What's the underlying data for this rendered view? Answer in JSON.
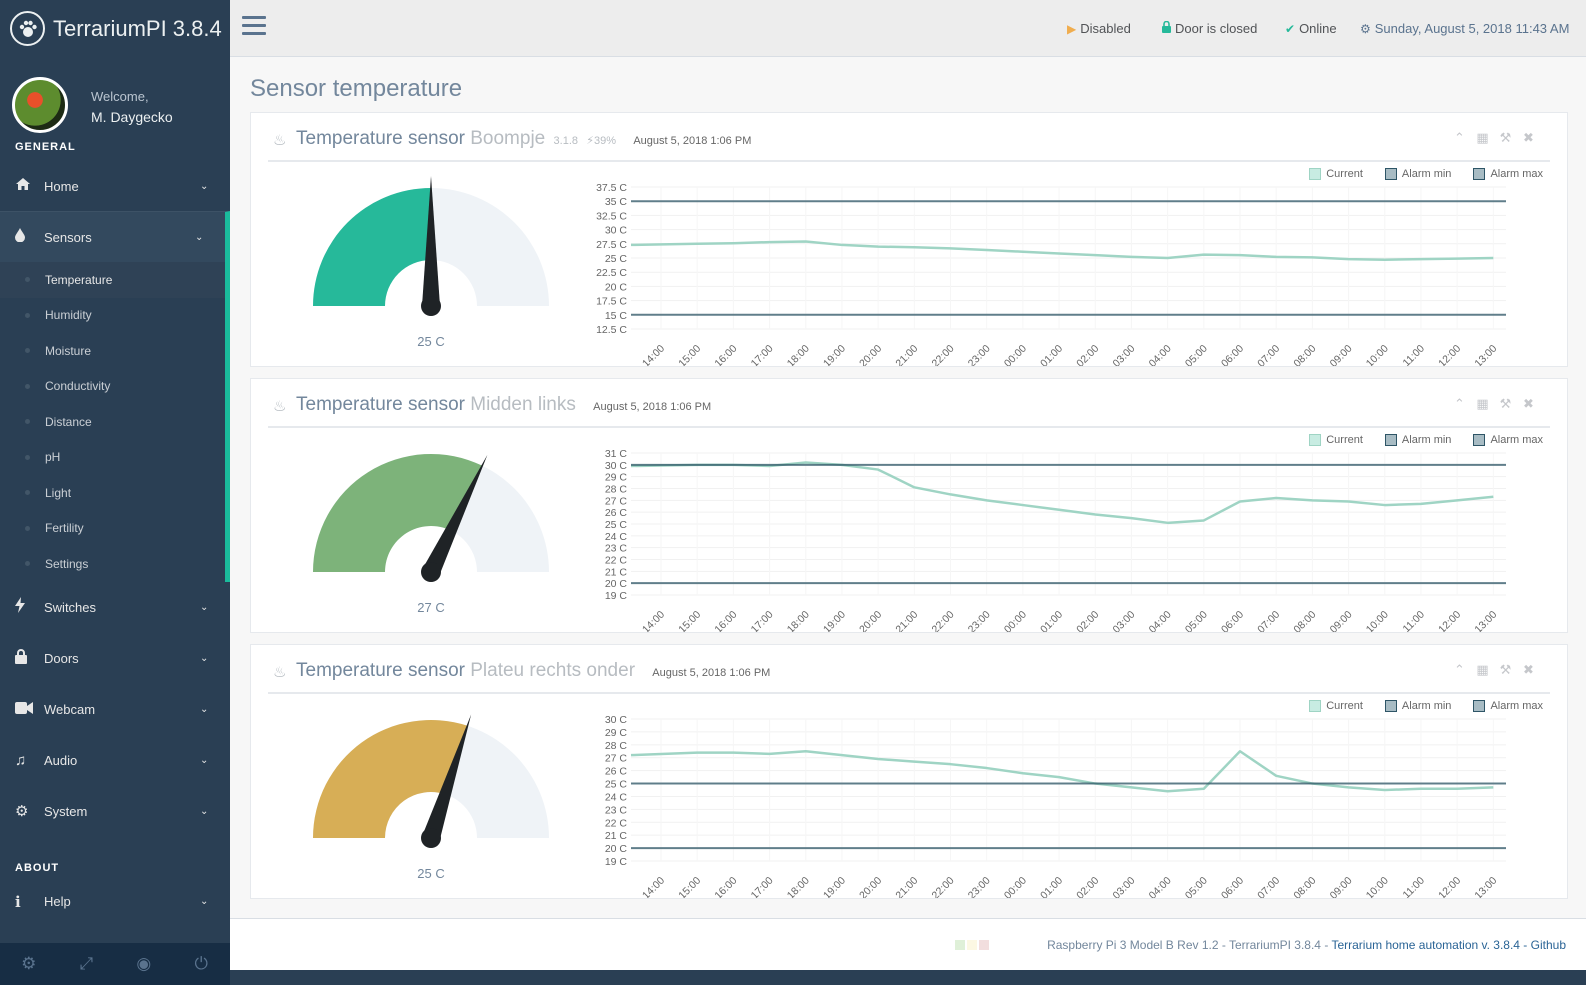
{
  "app": {
    "title": "TerrariumPI 3.8.4"
  },
  "profile": {
    "welcome": "Welcome,",
    "name": "M. Daygecko"
  },
  "sidebar": {
    "section_general": "GENERAL",
    "section_about": "ABOUT",
    "items": [
      {
        "label": "Home",
        "icon": "home-icon"
      },
      {
        "label": "Sensors",
        "icon": "drop-icon"
      },
      {
        "label": "Switches",
        "icon": "bolt-icon"
      },
      {
        "label": "Doors",
        "icon": "lock-icon"
      },
      {
        "label": "Webcam",
        "icon": "video-icon"
      },
      {
        "label": "Audio",
        "icon": "music-icon"
      },
      {
        "label": "System",
        "icon": "gear-icon"
      },
      {
        "label": "Help",
        "icon": "info-icon"
      }
    ],
    "sensor_sub": [
      "Temperature",
      "Humidity",
      "Moisture",
      "Conductivity",
      "Distance",
      "pH",
      "Light",
      "Fertility",
      "Settings"
    ]
  },
  "topbar": {
    "disabled": "Disabled",
    "door": "Door is closed",
    "online": "Online",
    "datetime": "Sunday, August 5, 2018 11:43 AM"
  },
  "page": {
    "title": "Sensor temperature"
  },
  "panels": [
    {
      "title_prefix": "Temperature sensor",
      "name": "Boompje",
      "version": "3.1.8",
      "battery": "39%",
      "timestamp": "August 5, 2018 1:06 PM",
      "gauge_label": "25 C"
    },
    {
      "title_prefix": "Temperature sensor",
      "name": "Midden links",
      "version": "",
      "battery": "",
      "timestamp": "August 5, 2018 1:06 PM",
      "gauge_label": "27 C"
    },
    {
      "title_prefix": "Temperature sensor",
      "name": "Plateu rechts onder",
      "version": "",
      "battery": "",
      "timestamp": "August 5, 2018 1:06 PM",
      "gauge_label": "25 C"
    }
  ],
  "legend": {
    "current": "Current",
    "alarm_min": "Alarm min",
    "alarm_max": "Alarm max"
  },
  "footer": {
    "text": "Raspberry Pi 3 Model B Rev 1.2 - TerrariumPI 3.8.4 - ",
    "link": "Terrarium home automation v. 3.8.4 - Github"
  },
  "colors": {
    "sidebar": "#2a3f54",
    "accent": "#1abb9c",
    "gauge_green": "#26b99a",
    "gauge_lightgreen": "#7db37a",
    "gauge_gold": "#d7ae56",
    "gauge_track": "#eff3f7",
    "line": "#9fd4c4",
    "alarm_line": "#2e5566"
  },
  "chart_data": [
    {
      "type": "line",
      "x": [
        "14:00",
        "15:00",
        "16:00",
        "17:00",
        "18:00",
        "19:00",
        "20:00",
        "21:00",
        "22:00",
        "23:00",
        "00:00",
        "01:00",
        "02:00",
        "03:00",
        "04:00",
        "05:00",
        "06:00",
        "07:00",
        "08:00",
        "09:00",
        "10:00",
        "11:00",
        "12:00",
        "13:00"
      ],
      "ylim": [
        12.5,
        37.5
      ],
      "yticks": [
        "12.5 C",
        "15 C",
        "17.5 C",
        "20 C",
        "22.5 C",
        "25 C",
        "27.5 C",
        "30 C",
        "32.5 C",
        "35 C",
        "37.5 C"
      ],
      "series": [
        {
          "name": "Current",
          "values": [
            27.3,
            27.5,
            27.6,
            27.8,
            27.9,
            27.3,
            27.0,
            26.9,
            26.7,
            26.4,
            26.1,
            25.8,
            25.5,
            25.2,
            25.0,
            25.6,
            25.5,
            25.2,
            25.1,
            24.8,
            24.7,
            24.8,
            24.9,
            25.0
          ]
        },
        {
          "name": "Alarm min",
          "values": [
            15,
            15,
            15,
            15,
            15,
            15,
            15,
            15,
            15,
            15,
            15,
            15,
            15,
            15,
            15,
            15,
            15,
            15,
            15,
            15,
            15,
            15,
            15,
            15
          ]
        },
        {
          "name": "Alarm max",
          "values": [
            35,
            35,
            35,
            35,
            35,
            35,
            35,
            35,
            35,
            35,
            35,
            35,
            35,
            35,
            35,
            35,
            35,
            35,
            35,
            35,
            35,
            35,
            35,
            35
          ]
        }
      ],
      "gauge_value": 25,
      "gauge_min": 10,
      "gauge_max": 40,
      "gauge_color": "#26b99a"
    },
    {
      "type": "line",
      "x": [
        "14:00",
        "15:00",
        "16:00",
        "17:00",
        "18:00",
        "19:00",
        "20:00",
        "21:00",
        "22:00",
        "23:00",
        "00:00",
        "01:00",
        "02:00",
        "03:00",
        "04:00",
        "05:00",
        "06:00",
        "07:00",
        "08:00",
        "09:00",
        "10:00",
        "11:00",
        "12:00",
        "13:00"
      ],
      "ylim": [
        19,
        31
      ],
      "yticks": [
        "19 C",
        "20 C",
        "21 C",
        "22 C",
        "23 C",
        "24 C",
        "25 C",
        "26 C",
        "27 C",
        "28 C",
        "29 C",
        "30 C",
        "31 C"
      ],
      "series": [
        {
          "name": "Current",
          "values": [
            29.9,
            30.0,
            30.0,
            29.9,
            30.2,
            30.0,
            29.6,
            28.1,
            27.5,
            27.0,
            26.6,
            26.2,
            25.8,
            25.5,
            25.1,
            25.3,
            26.9,
            27.2,
            27.0,
            26.9,
            26.6,
            26.7,
            27.0,
            27.3
          ]
        },
        {
          "name": "Alarm min",
          "values": [
            20,
            20,
            20,
            20,
            20,
            20,
            20,
            20,
            20,
            20,
            20,
            20,
            20,
            20,
            20,
            20,
            20,
            20,
            20,
            20,
            20,
            20,
            20,
            20
          ]
        },
        {
          "name": "Alarm max",
          "values": [
            30,
            30,
            30,
            30,
            30,
            30,
            30,
            30,
            30,
            30,
            30,
            30,
            30,
            30,
            30,
            30,
            30,
            30,
            30,
            30,
            30,
            30,
            30,
            30
          ]
        }
      ],
      "gauge_value": 27,
      "gauge_min": 18,
      "gauge_max": 32,
      "gauge_color": "#7db37a"
    },
    {
      "type": "line",
      "x": [
        "14:00",
        "15:00",
        "16:00",
        "17:00",
        "18:00",
        "19:00",
        "20:00",
        "21:00",
        "22:00",
        "23:00",
        "00:00",
        "01:00",
        "02:00",
        "03:00",
        "04:00",
        "05:00",
        "06:00",
        "07:00",
        "08:00",
        "09:00",
        "10:00",
        "11:00",
        "12:00",
        "13:00"
      ],
      "ylim": [
        19,
        30
      ],
      "yticks": [
        "19 C",
        "20 C",
        "21 C",
        "22 C",
        "23 C",
        "24 C",
        "25 C",
        "26 C",
        "27 C",
        "28 C",
        "29 C",
        "30 C"
      ],
      "series": [
        {
          "name": "Current",
          "values": [
            27.2,
            27.4,
            27.4,
            27.3,
            27.5,
            27.2,
            26.9,
            26.7,
            26.5,
            26.2,
            25.8,
            25.5,
            25.0,
            24.7,
            24.4,
            24.6,
            27.5,
            25.6,
            25.0,
            24.7,
            24.5,
            24.6,
            24.6,
            24.7
          ]
        },
        {
          "name": "Alarm min",
          "values": [
            20,
            20,
            20,
            20,
            20,
            20,
            20,
            20,
            20,
            20,
            20,
            20,
            20,
            20,
            20,
            20,
            20,
            20,
            20,
            20,
            20,
            20,
            20,
            20
          ]
        },
        {
          "name": "Alarm max",
          "values": [
            25,
            25,
            25,
            25,
            25,
            25,
            25,
            25,
            25,
            25,
            25,
            25,
            25,
            25,
            25,
            25,
            25,
            25,
            25,
            25,
            25,
            25,
            25,
            25
          ]
        }
      ],
      "gauge_value": 25,
      "gauge_min": 10,
      "gauge_max": 35,
      "gauge_color": "#d7ae56"
    }
  ]
}
